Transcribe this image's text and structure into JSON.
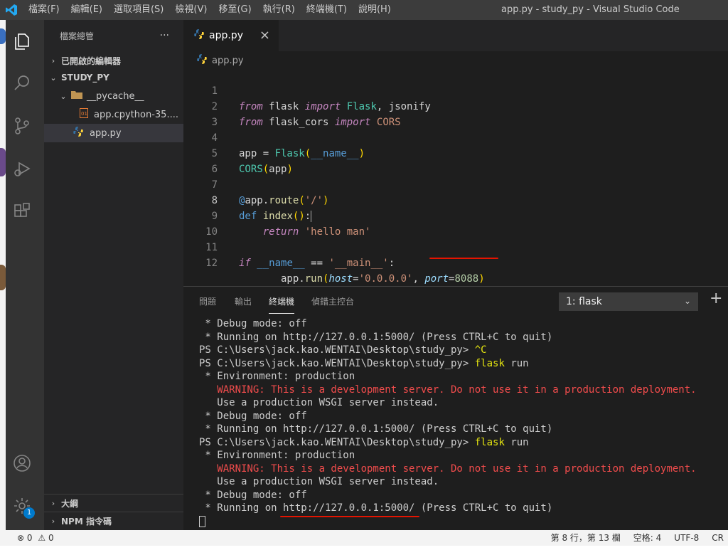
{
  "titlebar": {
    "menu": [
      "檔案(F)",
      "編輯(E)",
      "選取項目(S)",
      "檢視(V)",
      "移至(G)",
      "執行(R)",
      "終端機(T)",
      "說明(H)"
    ],
    "window_title": "app.py - study_py - Visual Studio Code"
  },
  "activitybar": {
    "icons": [
      "explorer-icon",
      "search-icon",
      "source-control-icon",
      "run-debug-icon",
      "extensions-icon",
      "account-icon",
      "manage-gear-icon"
    ],
    "manage_badge": "1"
  },
  "sidebar": {
    "header": "檔案總管",
    "more": "···",
    "open_editors": "已開啟的編輯器",
    "project": "STUDY_PY",
    "folder": "__pycache__",
    "cache_file": "app.cpython-35....",
    "main_file": "app.py",
    "outline": "大綱",
    "npm": "NPM 指令碼"
  },
  "editor": {
    "tab_label": "app.py",
    "breadcrumb": "app.py",
    "line_numbers": [
      "1",
      "2",
      "3",
      "4",
      "5",
      "6",
      "7",
      "8",
      "9",
      "10",
      "11",
      "12"
    ],
    "current_line": "8"
  },
  "panel": {
    "tabs": [
      "問題",
      "輸出",
      "終端機",
      "偵錯主控台"
    ],
    "active_tab": "終端機",
    "terminal_select": "1: flask",
    "terminal_lines": [
      " * Debug mode: off",
      " * Running on http://127.0.0.1:5000/ (Press CTRL+C to quit)",
      "PS C:\\Users\\jack.kao.WENTAI\\Desktop\\study_py> ",
      "PS C:\\Users\\jack.kao.WENTAI\\Desktop\\study_py> ",
      " * Environment: production",
      "   WARNING: This is a development server. Do not use it in a production deployment.",
      "   Use a production WSGI server instead.",
      " * Debug mode: off",
      " * Running on http://127.0.0.1:5000/ (Press CTRL+C to quit)",
      "PS C:\\Users\\jack.kao.WENTAI\\Desktop\\study_py> ",
      " * Environment: production",
      "   WARNING: This is a development server. Do not use it in a production deployment.",
      "   Use a production WSGI server instead.",
      " * Debug mode: off",
      " * Running on http://127.0.0.1:5000/ (Press CTRL+C to quit)"
    ],
    "ctrl_c": "^C",
    "flask_cmd": "flask",
    "run_arg": " run"
  },
  "statusbar": {
    "errors": "0",
    "warnings": "0",
    "position": "第 8 行，第 13 欄",
    "spaces": "空格: 4",
    "encoding": "UTF-8",
    "crlf": "CR"
  },
  "colors": {
    "accent": "#007acc",
    "annotation_red": "#e51400",
    "warning_red": "#f14c4c"
  }
}
